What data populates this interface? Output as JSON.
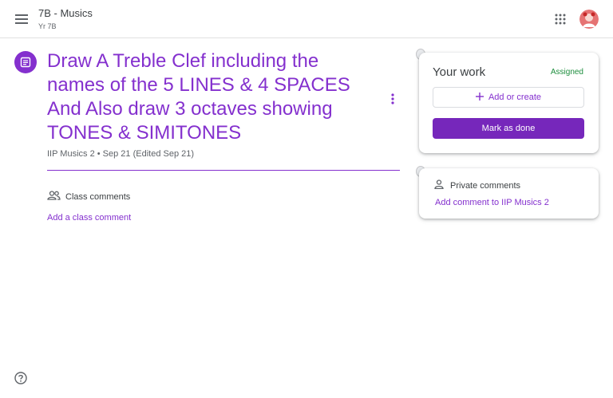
{
  "header": {
    "class_title": "7B - Musics",
    "class_subtitle": "Yr 7B",
    "menu_icon": "hamburger-menu-icon",
    "apps_icon": "apps-grid-icon",
    "avatar_icon": "account-avatar"
  },
  "assignment": {
    "title": "Draw A Treble Clef including the names of the 5 LINES & 4 SPACES And Also draw 3 octaves showing TONES & SIMITONES",
    "meta": "IIP Musics 2 • Sep 21 (Edited Sep 21)",
    "icon": "assignment-icon",
    "accent_color": "#8430ce"
  },
  "class_comments": {
    "label": "Class comments",
    "add_label": "Add a class comment",
    "icon": "people-icon"
  },
  "your_work": {
    "title": "Your work",
    "status": "Assigned",
    "status_color": "#1e8e3e",
    "add_create_label": "Add or create",
    "mark_done_label": "Mark as done",
    "button_color": "#7627bb"
  },
  "private_comments": {
    "label": "Private comments",
    "add_label": "Add comment to IIP Musics 2",
    "icon": "person-icon"
  },
  "footer": {
    "help_icon": "help-icon"
  }
}
